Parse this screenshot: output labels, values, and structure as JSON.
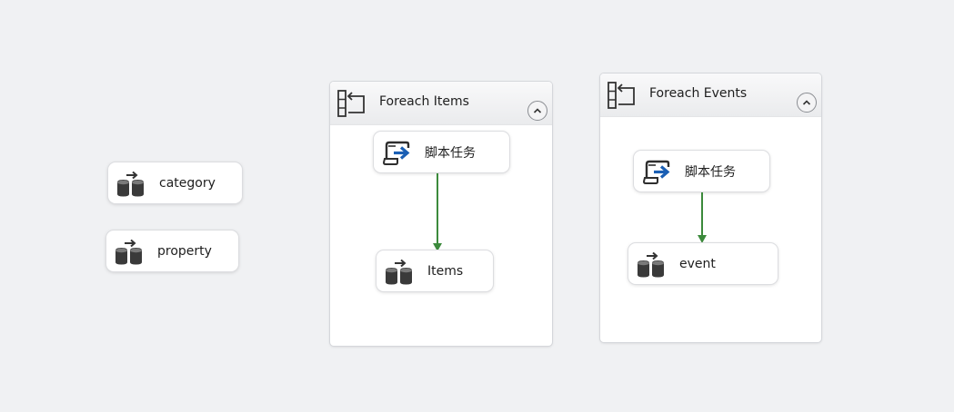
{
  "canvas": {
    "background": "#f0f1f3"
  },
  "standalone_tasks": [
    {
      "label": "category",
      "icon": "data-flow-task-icon"
    },
    {
      "label": "property",
      "icon": "data-flow-task-icon"
    }
  ],
  "containers": [
    {
      "title": "Foreach Items",
      "icon": "foreach-loop-icon",
      "collapse_icon": "chevron-up-icon",
      "tasks": [
        {
          "label": "脚本任务",
          "icon": "script-task-icon"
        },
        {
          "label": "Items",
          "icon": "data-flow-task-icon"
        }
      ]
    },
    {
      "title": "Foreach Events",
      "icon": "foreach-loop-icon",
      "collapse_icon": "chevron-up-icon",
      "tasks": [
        {
          "label": "脚本任务",
          "icon": "script-task-icon"
        },
        {
          "label": "event",
          "icon": "data-flow-task-icon"
        }
      ]
    }
  ],
  "colors": {
    "precedence_constraint_success": "#3c8a3c",
    "script_arrow": "#1a5fb4"
  }
}
